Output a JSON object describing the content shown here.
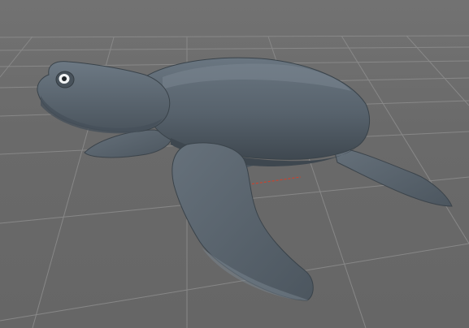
{
  "viewport": {
    "kind": "3d-modeling-viewport",
    "model": "sea-turtle-lowpoly",
    "background_color": "#6b6b6b",
    "grid_color": "#8a8a8a",
    "model_color": "#5b6670",
    "axis_x_color": "#c8432f",
    "grid_visible": true
  }
}
